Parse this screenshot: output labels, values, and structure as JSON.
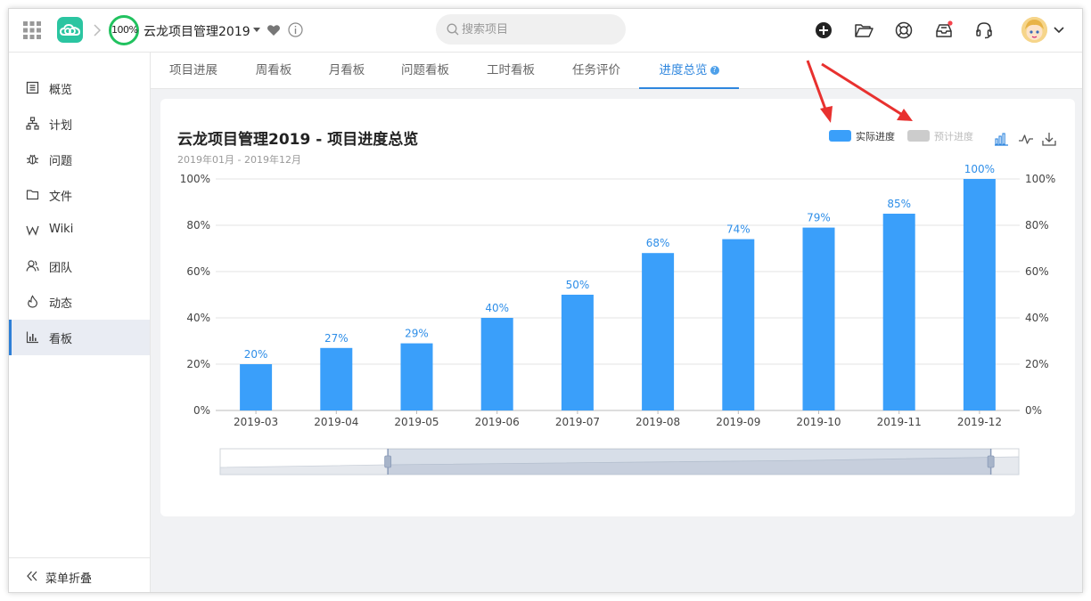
{
  "header": {
    "progress": "100%",
    "project_name": "云龙项目管理2019",
    "search_placeholder": "搜索项目"
  },
  "sidebar": {
    "items": [
      {
        "label": "概览"
      },
      {
        "label": "计划"
      },
      {
        "label": "问题"
      },
      {
        "label": "文件"
      },
      {
        "label": "Wiki"
      },
      {
        "label": "团队"
      },
      {
        "label": "动态"
      },
      {
        "label": "看板"
      }
    ],
    "collapse_label": "菜单折叠"
  },
  "tabs": [
    {
      "label": "项目进展"
    },
    {
      "label": "周看板"
    },
    {
      "label": "月看板"
    },
    {
      "label": "问题看板"
    },
    {
      "label": "工时看板"
    },
    {
      "label": "任务评价"
    },
    {
      "label": "进度总览"
    }
  ],
  "colors": {
    "accent": "#2e86de",
    "bar": "#3a9ffa",
    "planned": "#cccccc",
    "ring": "#21c25f"
  },
  "card": {
    "title": "云龙项目管理2019 - 项目进度总览",
    "subtitle": "2019年01月 - 2019年12月",
    "legend_actual": "实际进度",
    "legend_planned": "预计进度"
  },
  "chart_data": {
    "type": "bar",
    "categories": [
      "2019-03",
      "2019-04",
      "2019-05",
      "2019-06",
      "2019-07",
      "2019-08",
      "2019-09",
      "2019-10",
      "2019-11",
      "2019-12"
    ],
    "series": [
      {
        "name": "实际进度",
        "values": [
          20,
          27,
          29,
          40,
          50,
          68,
          74,
          79,
          85,
          100
        ],
        "color": "#3a9ffa"
      }
    ],
    "data_labels": [
      "20%",
      "27%",
      "29%",
      "40%",
      "50%",
      "68%",
      "74%",
      "79%",
      "85%",
      "100%"
    ],
    "ylim": [
      0,
      100
    ],
    "y_ticks": [
      "0%",
      "20%",
      "40%",
      "60%",
      "80%",
      "100%"
    ],
    "y_tick_values": [
      0,
      20,
      40,
      60,
      80,
      100
    ],
    "right_axis": true,
    "grid": true,
    "legend_position": "top-right"
  }
}
